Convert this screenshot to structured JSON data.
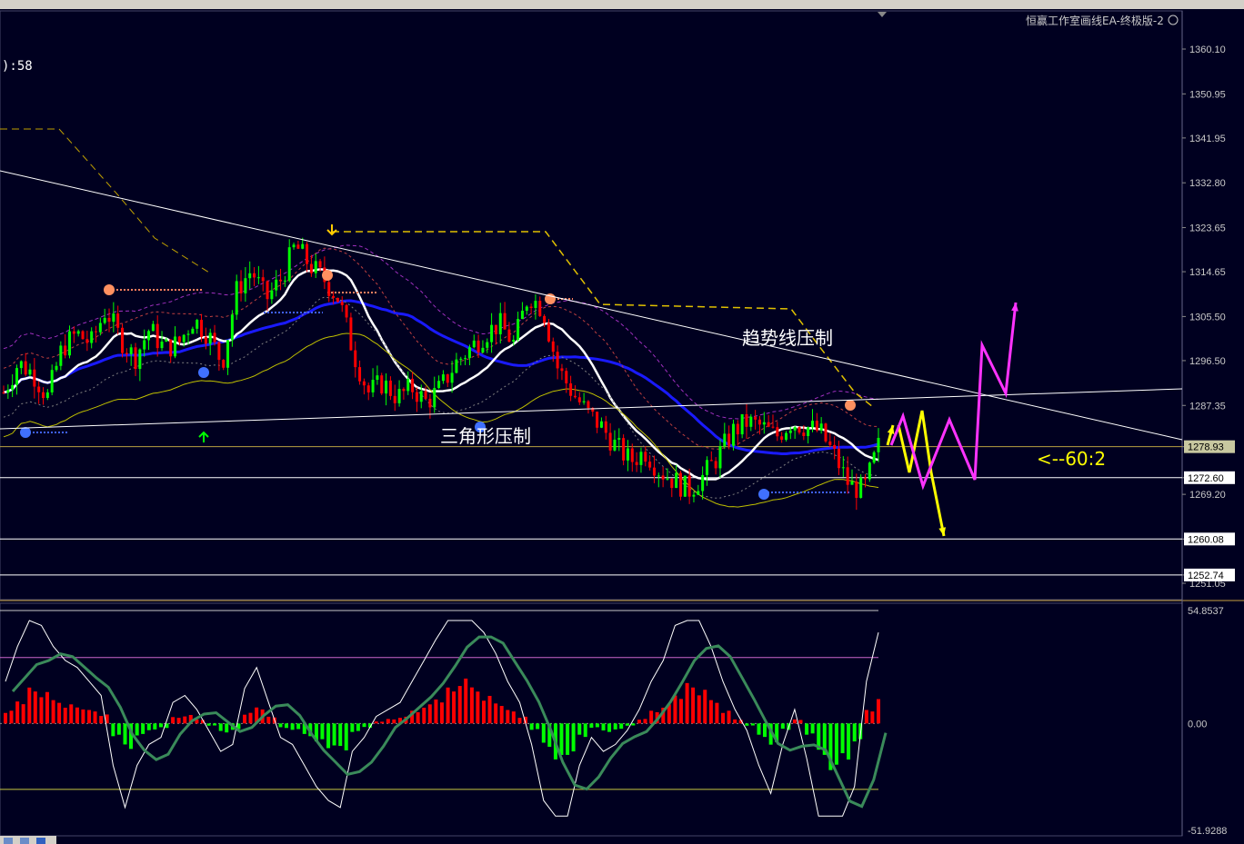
{
  "window": {
    "ea_label": "恒赢工作室画线EA-终极版-2",
    "clock_fragment": "):58"
  },
  "annotations": {
    "trendline_label": "趋势线压制",
    "triangle_label": "三角形压制",
    "ratio_label": "<--60:2"
  },
  "colors": {
    "background": "#000020",
    "bull": "#00ff00",
    "bear": "#ff0000",
    "ma_fast": "#ffffff",
    "ma_slow": "#1a1aff",
    "projection_yellow": "#ffff00",
    "projection_magenta": "#ff33ff"
  },
  "chart_data": [
    {
      "type": "candlestick",
      "name": "price",
      "ylim": [
        1251.05,
        1364
      ],
      "y_ticks": [
        "1360.10",
        "1350.95",
        "1341.95",
        "1332.80",
        "1323.65",
        "1314.65",
        "1305.50",
        "1296.50",
        "1287.35",
        "1278.93",
        "1272.60",
        "1269.20",
        "1260.08",
        "1252.74",
        "1251.05"
      ],
      "horizontal_levels": [
        1278.93,
        1272.6,
        1260.08,
        1252.74
      ],
      "level_tags": [
        "1278.93",
        "1272.60",
        "1260.08",
        "1252.74"
      ],
      "close_path": [
        1290,
        1296,
        1294,
        1289,
        1299,
        1302,
        1300,
        1307,
        1301,
        1297,
        1303,
        1299,
        1300,
        1305,
        1302,
        1296,
        1311,
        1315,
        1309,
        1313,
        1320,
        1316,
        1313,
        1309,
        1298,
        1290,
        1292,
        1289,
        1291,
        1288,
        1291,
        1296,
        1299,
        1302,
        1304,
        1300,
        1310,
        1307,
        1295,
        1290,
        1286,
        1283,
        1279,
        1276,
        1278,
        1274,
        1272,
        1270,
        1273,
        1277,
        1282,
        1284,
        1283,
        1281,
        1284,
        1283,
        1282,
        1277,
        1271,
        1270,
        1279
      ]
    },
    {
      "type": "histogram",
      "name": "oscillator",
      "ylim": [
        -51.9288,
        54.8537
      ],
      "y_ticks": [
        "54.8537",
        "0.00",
        "-51.9288"
      ],
      "values": [
        6,
        11,
        16,
        14,
        11,
        9,
        8,
        6,
        4,
        -6,
        -12,
        -6,
        -3,
        -2,
        3,
        4,
        2,
        -1,
        -4,
        -3,
        5,
        8,
        3,
        -2,
        -3,
        -6,
        -9,
        -11,
        -12,
        -4,
        -2,
        1,
        2,
        3,
        6,
        9,
        12,
        16,
        20,
        17,
        13,
        10,
        6,
        3,
        -3,
        -11,
        -18,
        -14,
        -6,
        -2,
        -4,
        -3,
        -1,
        2,
        6,
        9,
        14,
        18,
        15,
        11,
        6,
        2,
        -1,
        -6,
        -10,
        -3,
        2,
        -5,
        -14,
        -22,
        -17,
        -9,
        6,
        13
      ]
    }
  ]
}
